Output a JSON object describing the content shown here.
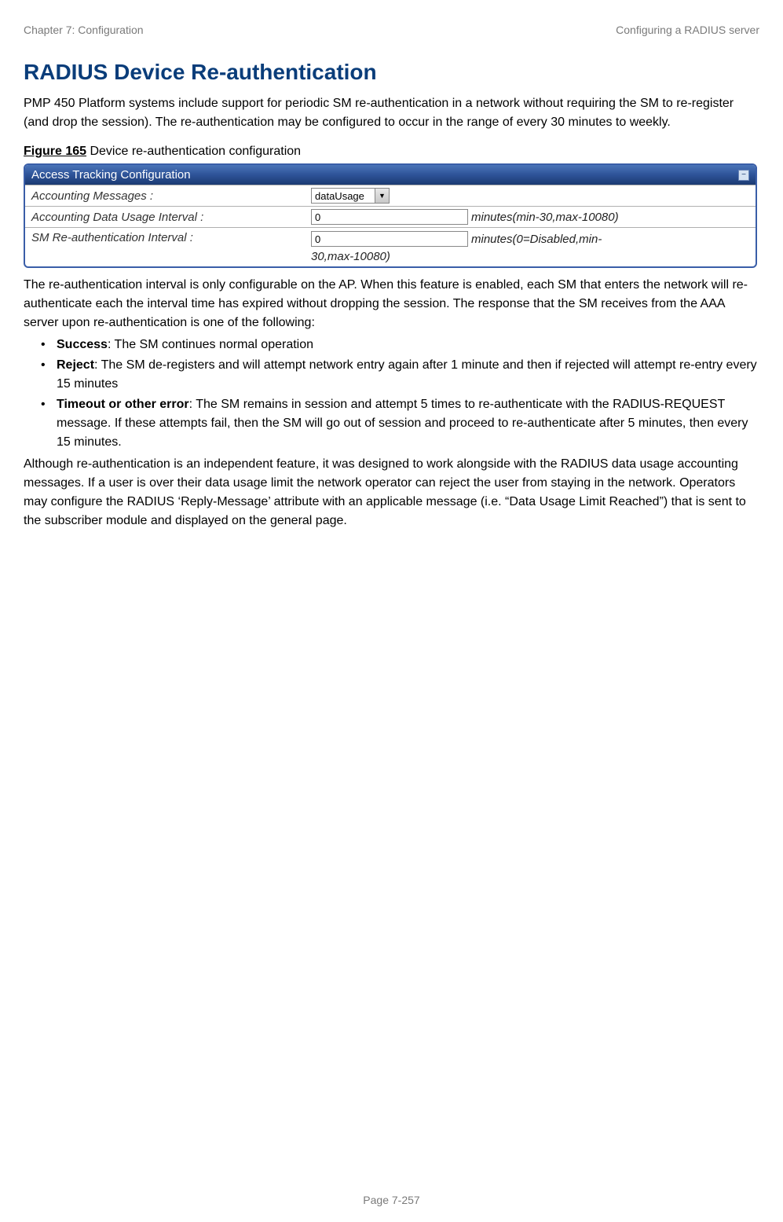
{
  "header": {
    "left": "Chapter 7:  Configuration",
    "right": "Configuring a RADIUS server"
  },
  "title": "RADIUS Device Re-authentication",
  "intro": "PMP 450 Platform systems include support for periodic SM re-authentication in a network without requiring the SM to re-register (and drop the session). The re-authentication may be configured to occur in the range of every 30 minutes to weekly.",
  "figure": {
    "label_bold": "Figure 165",
    "label_rest": " Device re-authentication configuration"
  },
  "panel": {
    "title": "Access Tracking Configuration",
    "rows": {
      "r1": {
        "label": "Accounting Messages :",
        "selectValue": "dataUsage"
      },
      "r2": {
        "label": "Accounting Data Usage Interval :",
        "inputValue": "0",
        "hint": "minutes(min-30,max-10080)"
      },
      "r3": {
        "label": "SM Re-authentication Interval :",
        "inputValue": "0",
        "hint1": "minutes(0=Disabled,min-",
        "hint2": "30,max-10080)"
      }
    }
  },
  "para1": "The re-authentication interval is only configurable on the AP. When this feature is enabled, each SM that enters the network will re-authenticate each the interval time has expired without dropping the session. The response that the SM receives from the AAA server upon re-authentication is one of the following:",
  "bullets": {
    "b1": {
      "bold": "Success",
      "rest": ": The SM continues normal operation"
    },
    "b2": {
      "bold": "Reject",
      "rest": ": The SM de-registers and will attempt network entry again after 1 minute and then if rejected will attempt re-entry every 15 minutes"
    },
    "b3": {
      "bold": "Timeout or other error",
      "rest": ": The SM remains in session and attempt 5 times to re-authenticate with the RADIUS-REQUEST message. If these attempts fail, then the SM will go out of session and proceed to re-authenticate after 5 minutes, then every 15 minutes."
    }
  },
  "para2": "Although re-authentication is an independent feature, it was designed to work alongside with the RADIUS data usage accounting messages. If a user is over their data usage limit the network operator can reject the user from staying in the network. Operators may configure the RADIUS ‘Reply-Message’ attribute with an applicable message (i.e. “Data Usage Limit Reached”) that is sent to the subscriber module and displayed on the general page.",
  "footer": "Page 7-257"
}
